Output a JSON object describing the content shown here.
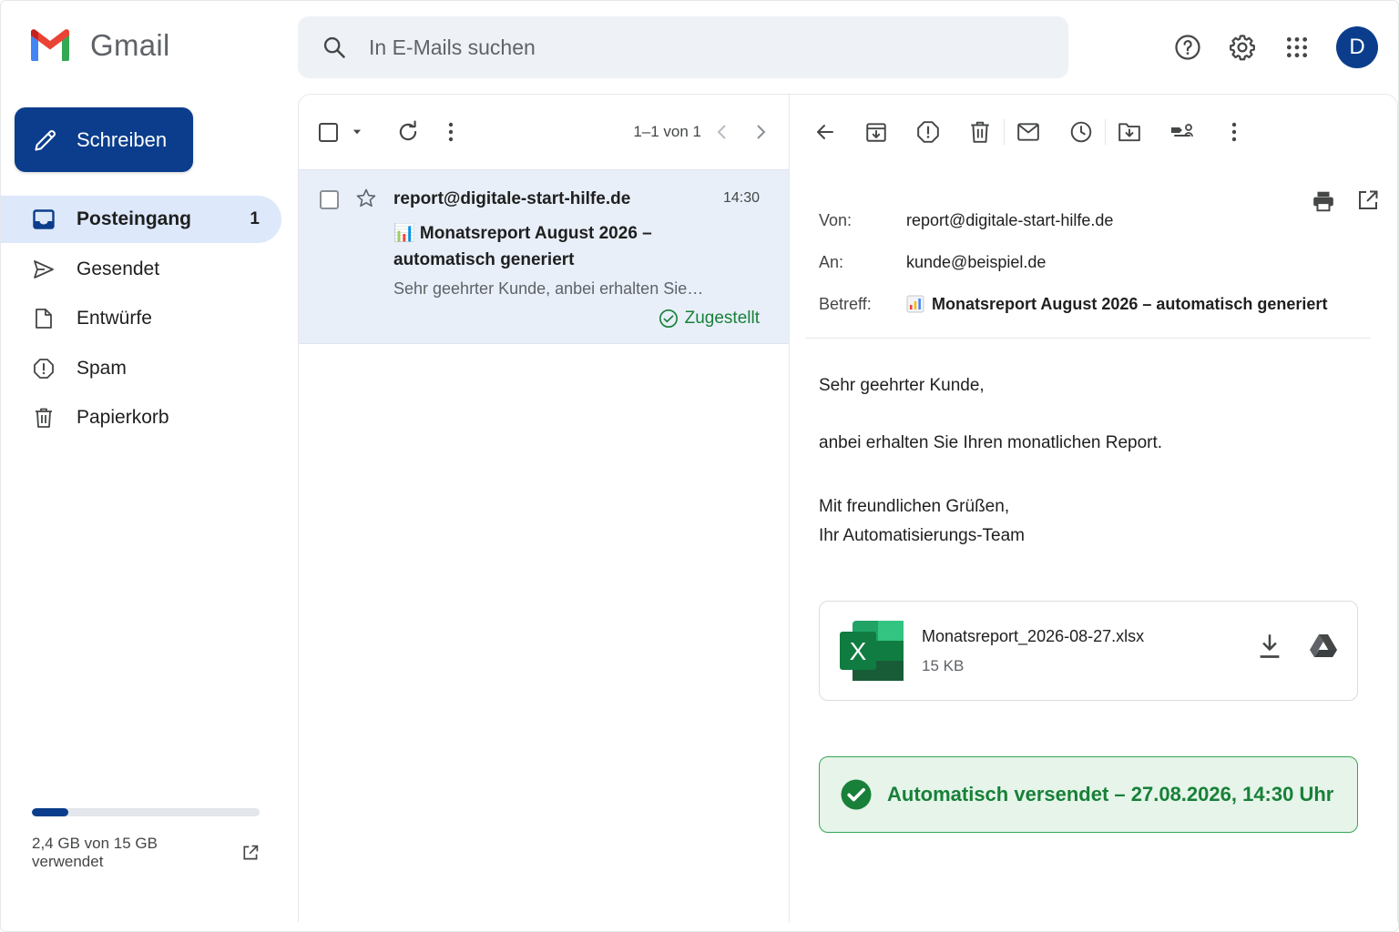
{
  "app": {
    "name": "Gmail"
  },
  "search": {
    "placeholder": "In E-Mails suchen"
  },
  "header": {
    "avatar_letter": "D"
  },
  "compose": {
    "label": "Schreiben"
  },
  "sidebar": {
    "items": [
      {
        "label": "Posteingang",
        "count": "1",
        "icon": "inbox-icon",
        "active": true
      },
      {
        "label": "Gesendet",
        "icon": "send-icon"
      },
      {
        "label": "Entwürfe",
        "icon": "draft-icon"
      },
      {
        "label": "Spam",
        "icon": "spam-icon"
      },
      {
        "label": "Papierkorb",
        "icon": "trash-icon"
      }
    ]
  },
  "storage": {
    "text": "2,4 GB von 15 GB verwendet",
    "used_fraction": 0.16
  },
  "list": {
    "pager": "1–1 von 1",
    "emails": [
      {
        "sender": "report@digitale-start-hilfe.de",
        "time": "14:30",
        "subject": "📊 Monatsreport August 2026 – automatisch generiert",
        "subject_text": "Monatsreport August 2026 – automatisch generiert",
        "preview": "Sehr geehrter Kunde, anbei erhalten Sie…",
        "status": "Zugestellt"
      }
    ]
  },
  "message": {
    "from_label": "Von:",
    "from": "report@digitale-start-hilfe.de",
    "to_label": "An:",
    "to": "kunde@beispiel.de",
    "subject_label": "Betreff:",
    "subject": "Monatsreport August 2026 – automatisch generiert",
    "body": {
      "greeting": "Sehr geehrter Kunde,",
      "line1": "anbei erhalten Sie Ihren monatlichen Report.",
      "closing": "Mit freundlichen Grüßen,",
      "signature": "Ihr Automatisierungs-Team"
    },
    "attachment": {
      "name": "Monatsreport_2026-08-27.xlsx",
      "size": "15 KB",
      "type_letter": "X"
    },
    "banner": "Automatisch versendet – 27.08.2026, 14:30 Uhr"
  },
  "colors": {
    "brand_blue": "#0b3d8c",
    "selected_row": "#e8eff9",
    "success_green": "#188038",
    "success_bg": "#e6f4ea"
  }
}
